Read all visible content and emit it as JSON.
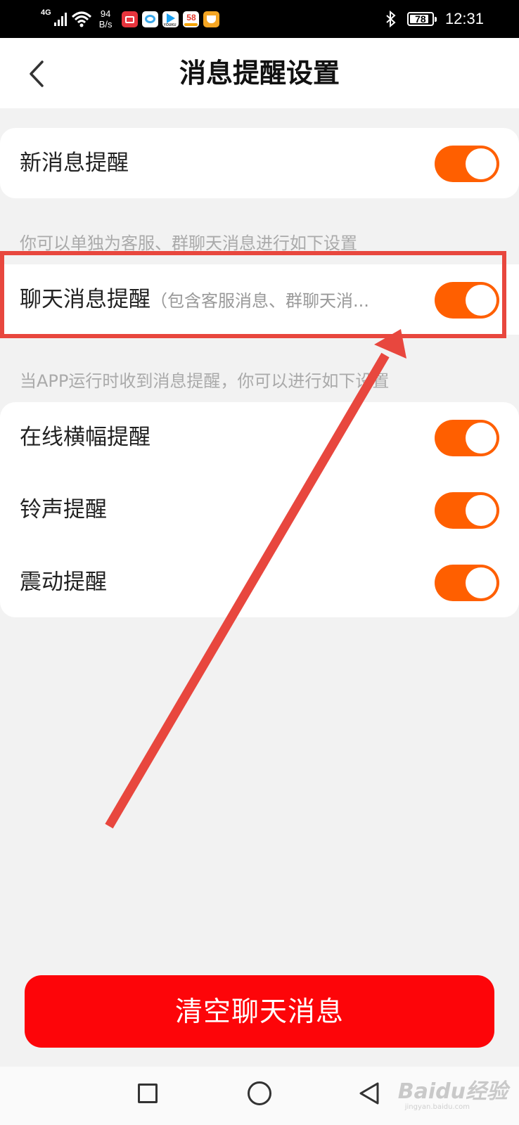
{
  "statusbar": {
    "network": "4G",
    "speed_value": "94",
    "speed_unit": "B/s",
    "battery": "78",
    "time": "12:31",
    "app_icons": [
      "calendar-app-icon",
      "cloud-app-icon",
      "youku-app-icon",
      "58-app-icon",
      "mail-app-icon"
    ],
    "youku_text": "YOUKU",
    "app58_text": "58"
  },
  "header": {
    "title": "消息提醒设置"
  },
  "settings": {
    "new_message": {
      "label": "新消息提醒",
      "enabled": true
    },
    "hint_individual": "你可以单独为客服、群聊天消息进行如下设置",
    "chat_message": {
      "label": "聊天消息提醒",
      "sublabel": "（包含客服消息、群聊天消...",
      "enabled": true
    },
    "hint_app_running": "当APP运行时收到消息提醒，你可以进行如下设置",
    "banner": {
      "label": "在线横幅提醒",
      "enabled": true
    },
    "ringtone": {
      "label": "铃声提醒",
      "enabled": true
    },
    "vibration": {
      "label": "震动提醒",
      "enabled": true
    }
  },
  "actions": {
    "clear_label": "清空聊天消息"
  },
  "watermark": {
    "text": "Baidu经验",
    "sub": "jingyan.baidu.com"
  },
  "colors": {
    "toggle_on": "#ff5f00",
    "clear_button": "#fd0509",
    "annotation": "#e8473e"
  }
}
